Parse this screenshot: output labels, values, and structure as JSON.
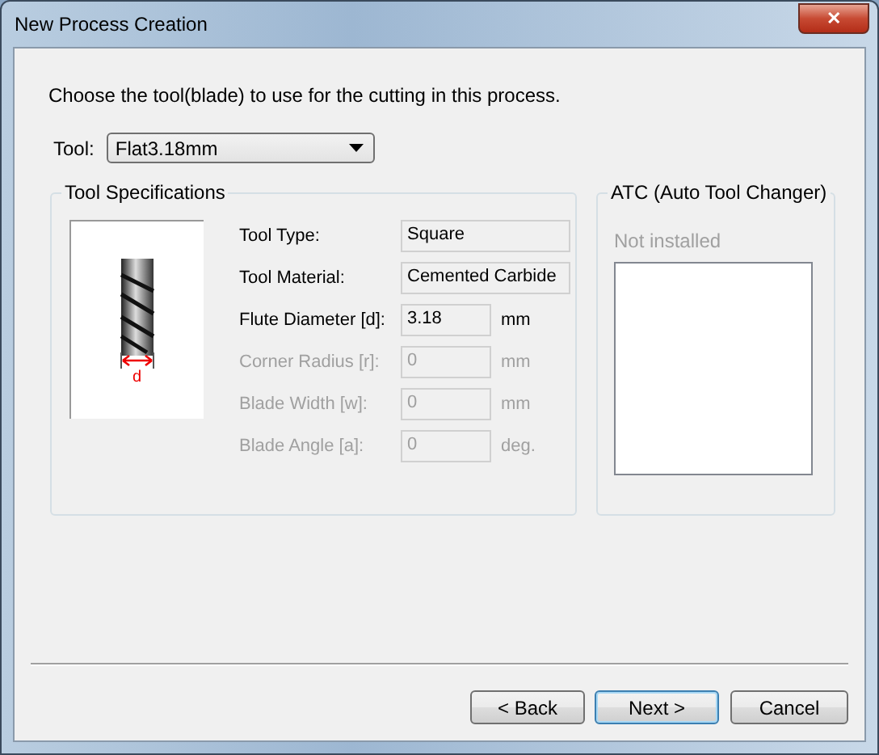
{
  "window": {
    "title": "New Process Creation",
    "close_label": "✕"
  },
  "instruction": "Choose the tool(blade) to use for the cutting in this process.",
  "tool_select": {
    "label": "Tool:",
    "value": "Flat3.18mm"
  },
  "specs": {
    "title": "Tool Specifications",
    "diagram_label": "d",
    "rows": [
      {
        "label": "Tool Type:",
        "value": "Square",
        "disabled": false
      },
      {
        "label": "Tool Material:",
        "value": "Cemented Carbide",
        "disabled": false
      },
      {
        "label": "Flute Diameter [d]:",
        "value": "3.18",
        "unit": "mm",
        "disabled": false
      },
      {
        "label": "Corner Radius [r]:",
        "value": "0",
        "unit": "mm",
        "disabled": true
      },
      {
        "label": "Blade Width [w]:",
        "value": "0",
        "unit": "mm",
        "disabled": true
      },
      {
        "label": "Blade Angle [a]:",
        "value": "0",
        "unit": "deg.",
        "disabled": true
      }
    ]
  },
  "atc": {
    "title": "ATC (Auto Tool Changer)",
    "status": "Not installed"
  },
  "buttons": [
    {
      "label": "< Back",
      "default": false
    },
    {
      "label": "Next >",
      "default": true
    },
    {
      "label": "Cancel",
      "default": false
    }
  ]
}
